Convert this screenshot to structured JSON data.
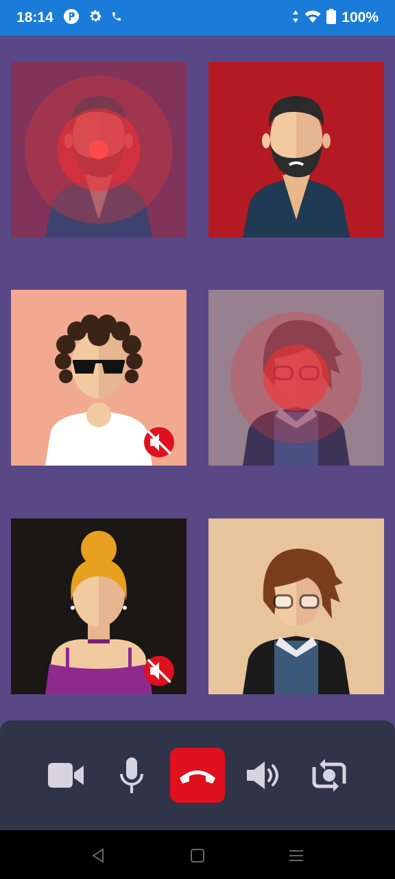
{
  "status_bar": {
    "time": "18:14",
    "battery_percent": "100%",
    "icons": [
      "p-badge-icon",
      "gear-icon",
      "phone-icon",
      "data-arrows-icon",
      "wifi-icon",
      "battery-icon"
    ]
  },
  "participants": [
    {
      "avatar": "bearded-man",
      "background": "#b31a24",
      "speaking": true,
      "muted": false
    },
    {
      "avatar": "bearded-man",
      "background": "#b31a24",
      "speaking": false,
      "muted": false
    },
    {
      "avatar": "curly-hair-sunglasses",
      "background": "#f1a98f",
      "speaking": false,
      "muted": true
    },
    {
      "avatar": "woman-glasses",
      "background": "#e8c49a",
      "speaking": true,
      "muted": false
    },
    {
      "avatar": "blonde-woman-bun",
      "background": "#1a1714",
      "speaking": false,
      "muted": true
    },
    {
      "avatar": "woman-glasses",
      "background": "#e8c49a",
      "speaking": false,
      "muted": false
    }
  ],
  "controls": {
    "items": [
      "video-camera-icon",
      "microphone-icon",
      "end-call-icon",
      "speaker-icon",
      "switch-camera-icon"
    ],
    "end_call_color": "#e0101e"
  },
  "nav_bar": {
    "items": [
      "back-icon",
      "home-icon",
      "menu-icon"
    ]
  }
}
